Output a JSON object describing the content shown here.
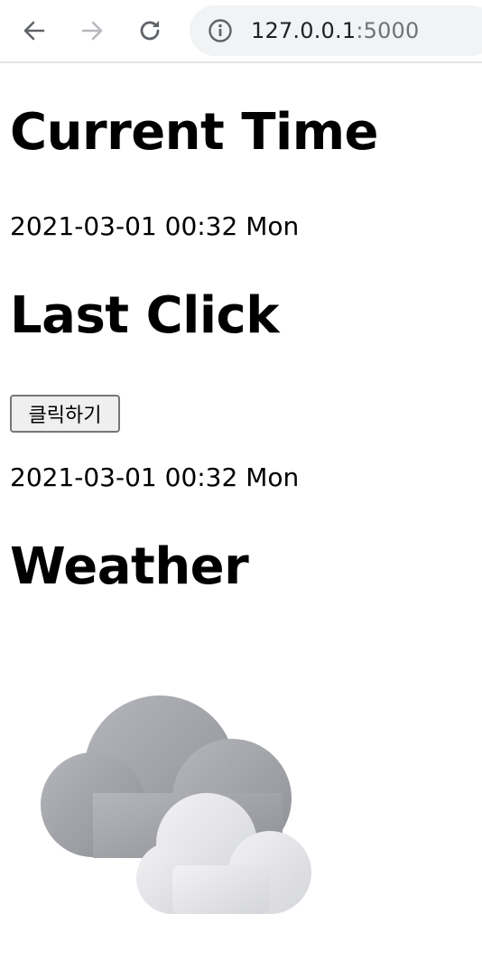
{
  "browser": {
    "url_host": "127.0.0.1",
    "url_port": ":5000"
  },
  "page": {
    "current_time_heading": "Current Time",
    "current_time_value": "2021-03-01 00:32 Mon",
    "last_click_heading": "Last Click",
    "click_button_label": "클릭하기",
    "last_click_value": "2021-03-01 00:32 Mon",
    "weather_heading": "Weather",
    "weather_icon": "cloudy-icon"
  }
}
